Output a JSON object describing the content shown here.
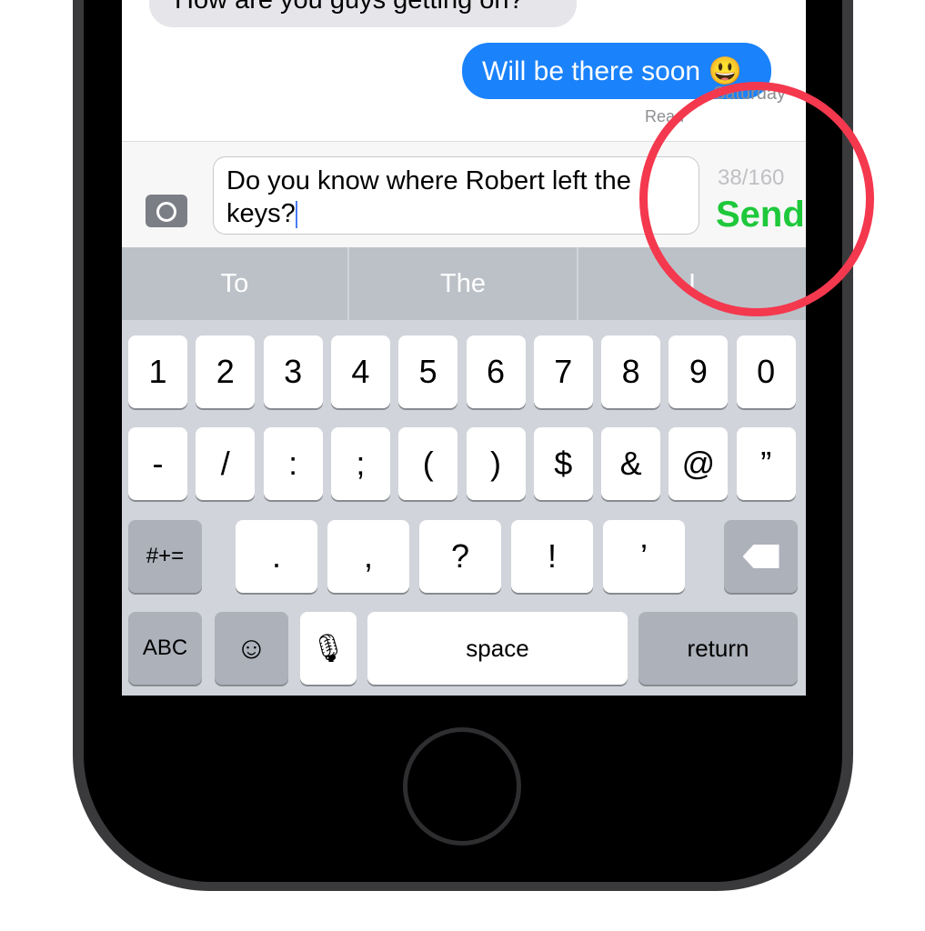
{
  "messages": {
    "incoming": "How are you guys getting on?",
    "outgoing": "Will be there soon 😃",
    "date": "Saturday",
    "read": "Read"
  },
  "composer": {
    "text_line1": "Do you know where Robert left the",
    "text_line2": "keys?",
    "counter": "38/160",
    "send_label": "Send"
  },
  "suggestions": [
    "To",
    "The",
    "I"
  ],
  "keyboard": {
    "row1": [
      "1",
      "2",
      "3",
      "4",
      "5",
      "6",
      "7",
      "8",
      "9",
      "0"
    ],
    "row2": [
      "-",
      "/",
      ":",
      ";",
      "(",
      ")",
      "$",
      "&",
      "@",
      "”"
    ],
    "row3": [
      ".",
      ",",
      "?",
      "!",
      "’"
    ],
    "symbols_label": "#+=",
    "abc_label": "ABC",
    "space_label": "space",
    "return_label": "return"
  },
  "colors": {
    "accent_send": "#1ec83b",
    "bubble_out": "#1a82fb",
    "highlight_ring": "#f4384e"
  }
}
